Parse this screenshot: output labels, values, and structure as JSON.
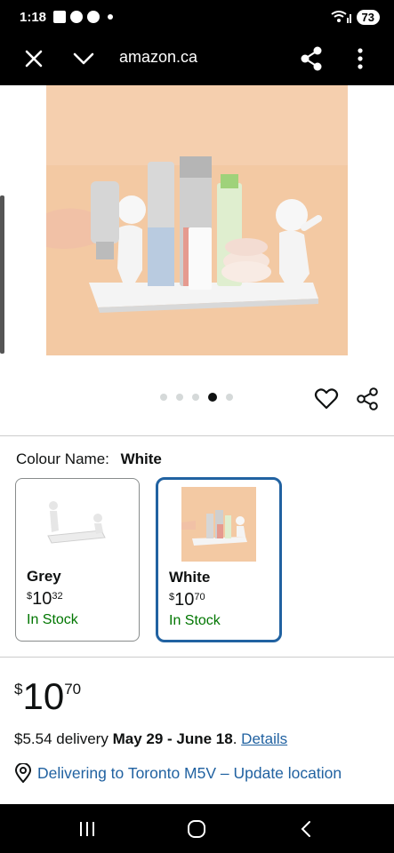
{
  "status_bar": {
    "time": "1:18",
    "battery": "73"
  },
  "browser": {
    "url": "amazon.ca"
  },
  "gallery": {
    "dot_count": 5,
    "active_dot_index": 3
  },
  "variation": {
    "label": "Colour Name:",
    "selected": "White"
  },
  "options": [
    {
      "name": "Grey",
      "currency": "$",
      "whole": "10",
      "fraction": "32",
      "stock": "In Stock"
    },
    {
      "name": "White",
      "currency": "$",
      "whole": "10",
      "fraction": "70",
      "stock": "In Stock"
    }
  ],
  "price": {
    "currency": "$",
    "whole": "10",
    "fraction": "70"
  },
  "delivery": {
    "prefix": "$5.54 delivery",
    "dates": "May 29 - June 18",
    "suffix": ".",
    "details_link": "Details"
  },
  "location": {
    "text": "Delivering to Toronto M5V – Update location"
  },
  "colors": {
    "link": "#2162a1",
    "in_stock": "#007600",
    "selected_border": "#2162a1"
  }
}
